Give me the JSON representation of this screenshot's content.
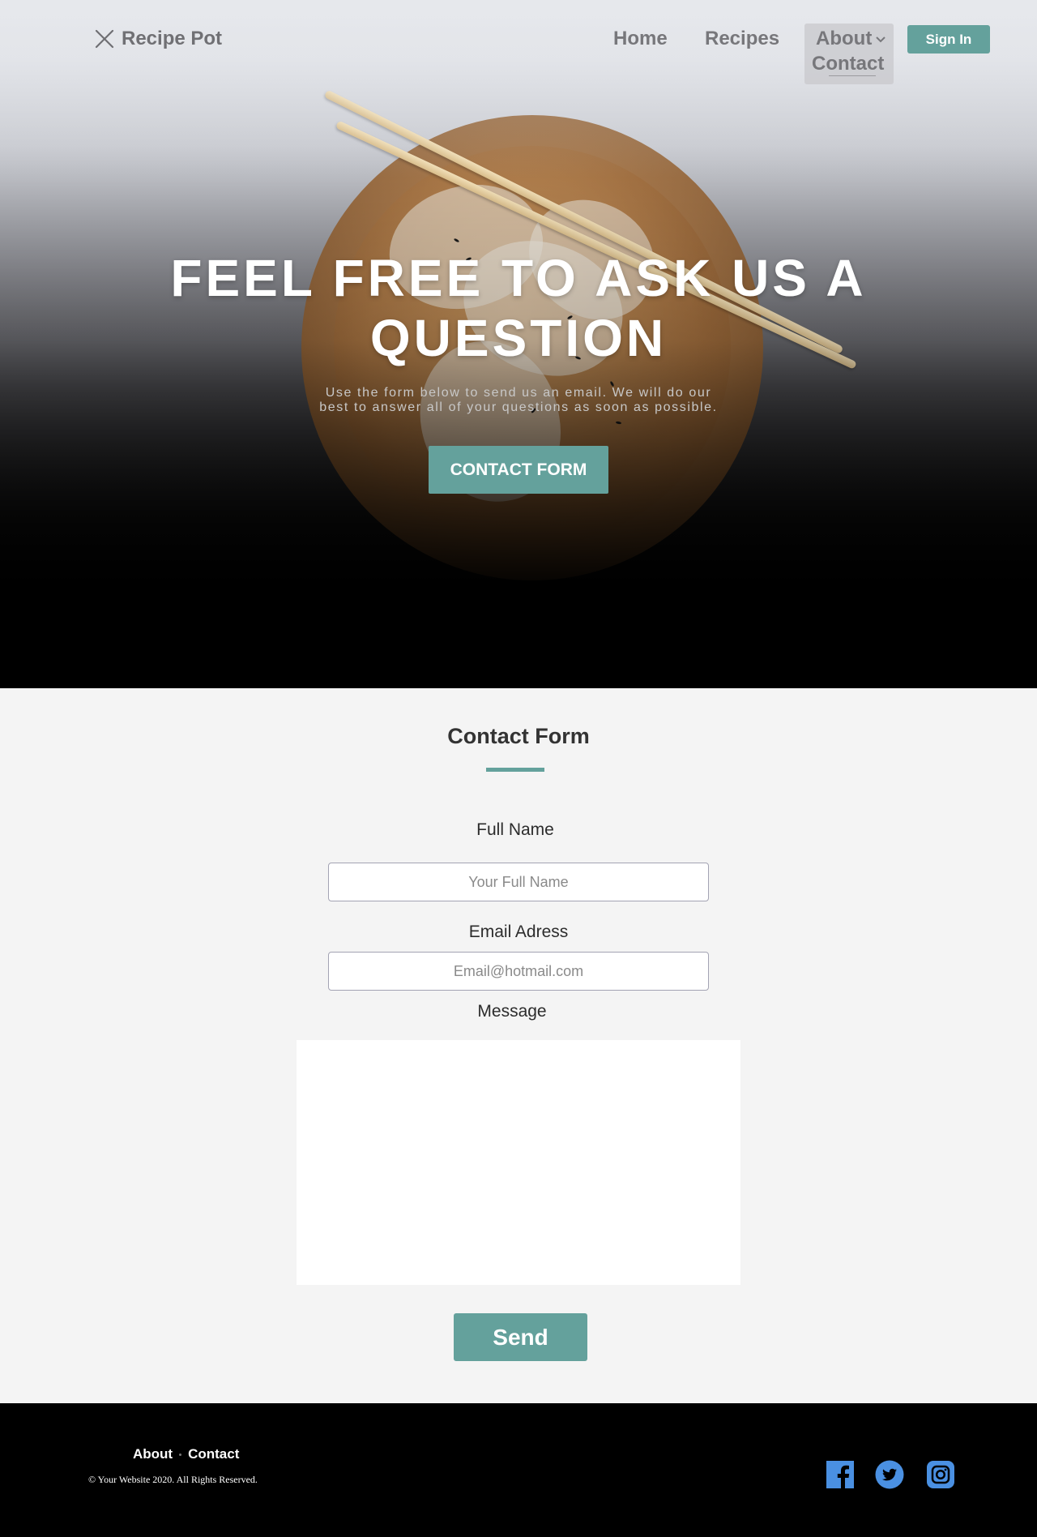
{
  "nav": {
    "logo_text": "Recipe Pot",
    "links": {
      "home": "Home",
      "recipes": "Recipes",
      "about": "About",
      "contact": "Contact"
    },
    "signin_label": "Sign In"
  },
  "hero": {
    "title_line1": "FEEL FREE TO ASK US A",
    "title_line2": "QUESTION",
    "subtitle_line1": "Use the form below to send us an email. We will do our",
    "subtitle_line2": "best to answer all of your questions as soon as possible.",
    "button_label": "CONTACT FORM"
  },
  "form": {
    "title": "Contact Form",
    "name_label": "Full Name",
    "name_placeholder": "Your Full Name",
    "email_label": "Email Adress",
    "email_placeholder": "Email@hotmail.com",
    "message_label": "Message",
    "message_value": "",
    "send_label": "Send"
  },
  "footer": {
    "links": {
      "about": "About",
      "contact": "Contact"
    },
    "copyright": "© Your Website 2020. All Rights Reserved.",
    "social_icons": [
      "facebook-icon",
      "twitter-icon",
      "instagram-icon"
    ]
  },
  "colors": {
    "accent": "#64a19c",
    "social_blue": "#4a90e2",
    "footer_bg": "#000000"
  }
}
